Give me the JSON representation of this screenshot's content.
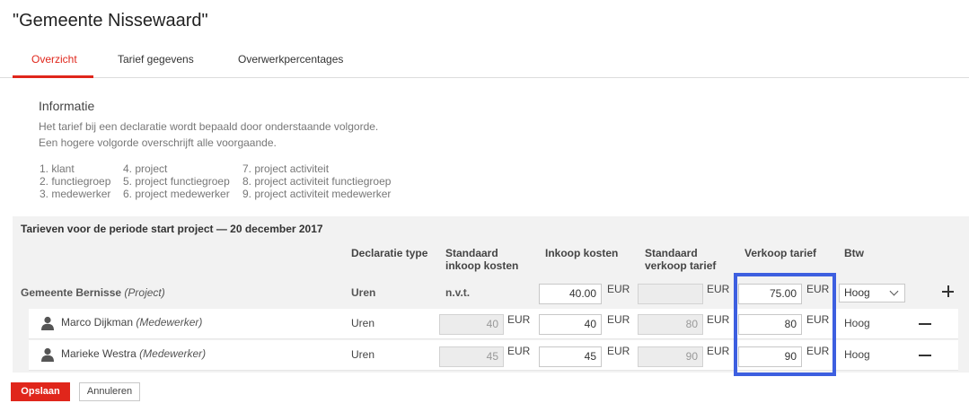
{
  "page": {
    "title": "\"Gemeente Nissewaard\""
  },
  "tabs": [
    {
      "label": "Overzicht",
      "active": true
    },
    {
      "label": "Tarief gegevens",
      "active": false
    },
    {
      "label": "Overwerkpercentages",
      "active": false
    }
  ],
  "info": {
    "title": "Informatie",
    "line1": "Het tarief bij een declaratie wordt bepaald door onderstaande volgorde.",
    "line2": "Een hogere volgorde overschrijft alle voorgaande.",
    "order": [
      "1. klant",
      "2. functiegroep",
      "3. medewerker",
      "4. project",
      "5. project functiegroep",
      "6. project medewerker",
      "7. project activiteit",
      "8. project activiteit functiegroep",
      "9. project activiteit medewerker"
    ]
  },
  "rates": {
    "header": "Tarieven voor de periode start project — 20 december 2017",
    "columns": {
      "type": "Declaratie type",
      "std_purchase_1": "Standaard",
      "std_purchase_2": "inkoop kosten",
      "purchase": "Inkoop kosten",
      "std_sale_1": "Standaard",
      "std_sale_2": "verkoop tarief",
      "sale": "Verkoop tarief",
      "vat": "Btw"
    },
    "currency": "EUR",
    "main_row": {
      "name": "Gemeente Bernisse",
      "kind": "(Project)",
      "type": "Uren",
      "std_purchase": "n.v.t.",
      "purchase": "40.00",
      "std_sale": "",
      "sale": "75.00",
      "vat": "Hoog"
    },
    "rows": [
      {
        "name": "Marco Dijkman",
        "kind": "(Medewerker)",
        "type": "Uren",
        "std_purchase": "40",
        "purchase": "40",
        "std_sale": "80",
        "sale": "80",
        "vat": "Hoog"
      },
      {
        "name": "Marieke Westra",
        "kind": "(Medewerker)",
        "type": "Uren",
        "std_purchase": "45",
        "purchase": "45",
        "std_sale": "90",
        "sale": "90",
        "vat": "Hoog"
      }
    ]
  },
  "actions": {
    "save": "Opslaan",
    "cancel": "Annuleren"
  },
  "colors": {
    "accent": "#e0261b",
    "highlight": "#3d5fe0"
  }
}
